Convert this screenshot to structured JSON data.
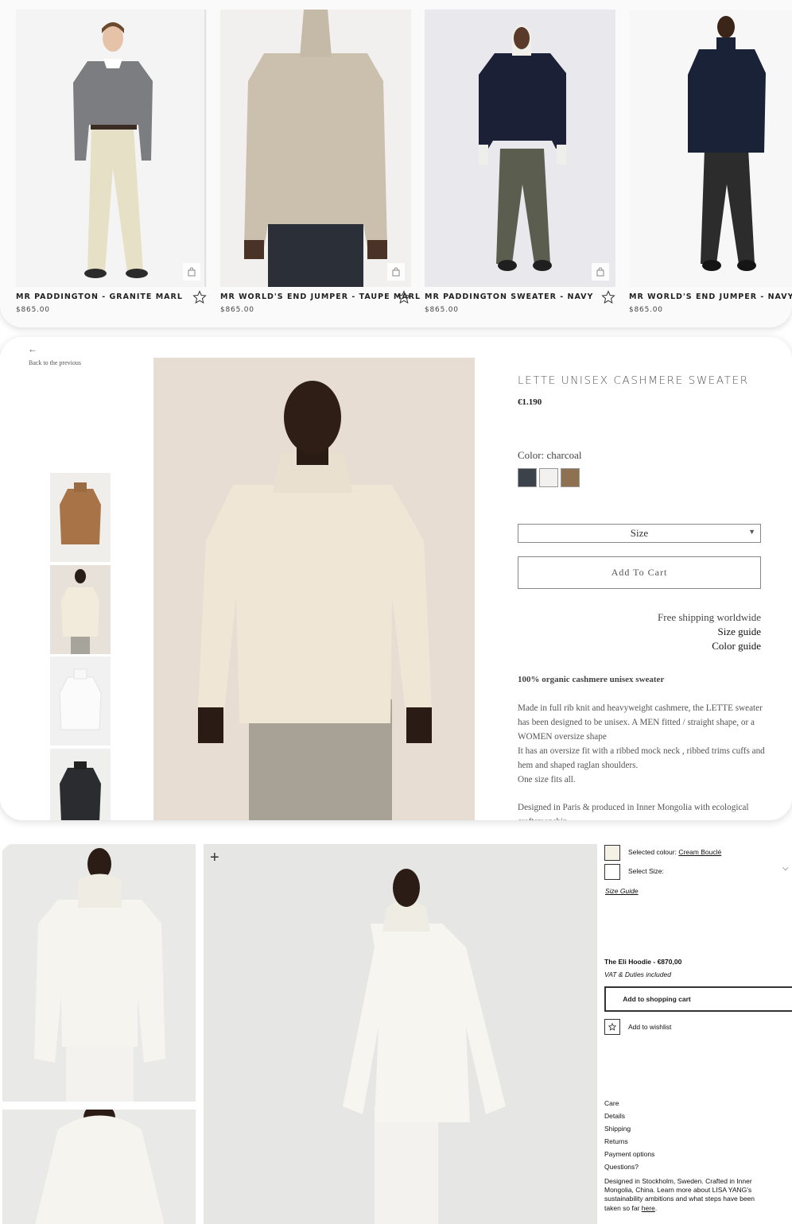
{
  "grid": {
    "products": [
      {
        "name": "MR PADDINGTON - GRANITE MARL",
        "price": "$865.00"
      },
      {
        "name": "MR WORLD'S END JUMPER - TAUPE MARL",
        "price": "$865.00"
      },
      {
        "name": "MR PADDINGTON SWEATER - NAVY",
        "price": "$865.00"
      },
      {
        "name": "MR WORLD'S END JUMPER - NAVY",
        "price": "$865.00"
      }
    ],
    "icons": {
      "bag": "shopping-bag-icon",
      "wishlist": "star-icon"
    }
  },
  "detail": {
    "back_arrow": "←",
    "back_label": "Back to the previous",
    "title": "LETTE UNISEX CASHMERE SWEATER",
    "price": "€1.190",
    "color_label": "Color: charcoal",
    "swatches": [
      "#3b4249",
      "#f3f1ef",
      "#8e7150"
    ],
    "size_placeholder": "Size",
    "add_to_cart": "Add To Cart",
    "shipping": "Free shipping worldwide",
    "size_guide": "Size guide",
    "color_guide": "Color guide",
    "subheading": "100% organic cashmere unisex sweater",
    "description": "Made in full rib knit and heavyweight cashmere, the LETTE sweater has been designed to be unisex. A MEN  fitted / straight shape, or a WOMEN oversize shape\nIt has an oversize fit with a ribbed mock neck , ribbed  trims cuffs and hem  and shaped raglan shoulders.\nOne size fits all.",
    "made_in": "Designed in Paris & produced in Inner Mongolia with ecological craftsmanship."
  },
  "hoodie": {
    "zoom": "+",
    "selected_colour_label": "Selected colour:",
    "selected_colour_value": "Cream Bouclé",
    "swatch_color": "#f6f1e7",
    "select_size": "Select Size:",
    "size_guide": "Size Guide",
    "title": "The Eli Hoodie - €870,00",
    "vat": "VAT & Duties included",
    "add_to_cart": "Add to shopping cart",
    "add_to_wishlist": "Add to wishlist",
    "menu": [
      "Care",
      "Details",
      "Shipping",
      "Returns",
      "Payment options",
      "Questions?"
    ],
    "footer_text": "Designed in Stockholm, Sweden. Crafted in Inner Mongolia, China. Learn more about LISA YANG's sustainability ambitions and what steps have been taken so far",
    "footer_link": "here",
    "footer_end": "."
  }
}
